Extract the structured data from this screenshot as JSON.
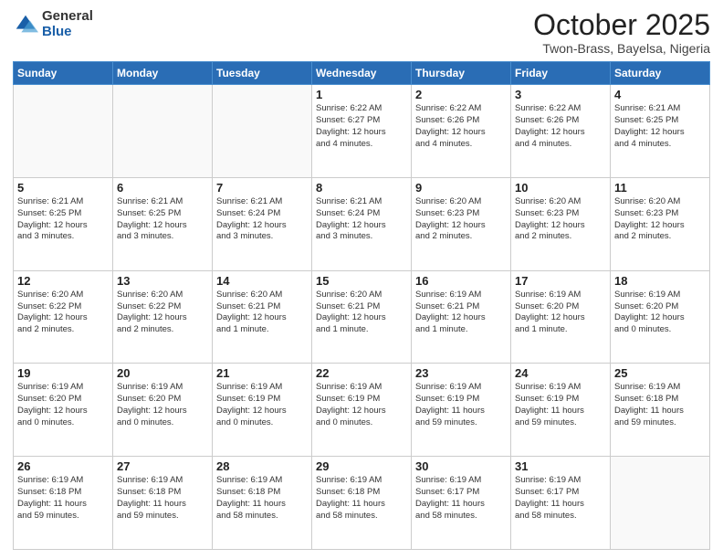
{
  "header": {
    "logo_general": "General",
    "logo_blue": "Blue",
    "main_title": "October 2025",
    "subtitle": "Twon-Brass, Bayelsa, Nigeria"
  },
  "calendar": {
    "headers": [
      "Sunday",
      "Monday",
      "Tuesday",
      "Wednesday",
      "Thursday",
      "Friday",
      "Saturday"
    ],
    "weeks": [
      [
        {
          "day": "",
          "info": ""
        },
        {
          "day": "",
          "info": ""
        },
        {
          "day": "",
          "info": ""
        },
        {
          "day": "1",
          "info": "Sunrise: 6:22 AM\nSunset: 6:27 PM\nDaylight: 12 hours\nand 4 minutes."
        },
        {
          "day": "2",
          "info": "Sunrise: 6:22 AM\nSunset: 6:26 PM\nDaylight: 12 hours\nand 4 minutes."
        },
        {
          "day": "3",
          "info": "Sunrise: 6:22 AM\nSunset: 6:26 PM\nDaylight: 12 hours\nand 4 minutes."
        },
        {
          "day": "4",
          "info": "Sunrise: 6:21 AM\nSunset: 6:25 PM\nDaylight: 12 hours\nand 4 minutes."
        }
      ],
      [
        {
          "day": "5",
          "info": "Sunrise: 6:21 AM\nSunset: 6:25 PM\nDaylight: 12 hours\nand 3 minutes."
        },
        {
          "day": "6",
          "info": "Sunrise: 6:21 AM\nSunset: 6:25 PM\nDaylight: 12 hours\nand 3 minutes."
        },
        {
          "day": "7",
          "info": "Sunrise: 6:21 AM\nSunset: 6:24 PM\nDaylight: 12 hours\nand 3 minutes."
        },
        {
          "day": "8",
          "info": "Sunrise: 6:21 AM\nSunset: 6:24 PM\nDaylight: 12 hours\nand 3 minutes."
        },
        {
          "day": "9",
          "info": "Sunrise: 6:20 AM\nSunset: 6:23 PM\nDaylight: 12 hours\nand 2 minutes."
        },
        {
          "day": "10",
          "info": "Sunrise: 6:20 AM\nSunset: 6:23 PM\nDaylight: 12 hours\nand 2 minutes."
        },
        {
          "day": "11",
          "info": "Sunrise: 6:20 AM\nSunset: 6:23 PM\nDaylight: 12 hours\nand 2 minutes."
        }
      ],
      [
        {
          "day": "12",
          "info": "Sunrise: 6:20 AM\nSunset: 6:22 PM\nDaylight: 12 hours\nand 2 minutes."
        },
        {
          "day": "13",
          "info": "Sunrise: 6:20 AM\nSunset: 6:22 PM\nDaylight: 12 hours\nand 2 minutes."
        },
        {
          "day": "14",
          "info": "Sunrise: 6:20 AM\nSunset: 6:21 PM\nDaylight: 12 hours\nand 1 minute."
        },
        {
          "day": "15",
          "info": "Sunrise: 6:20 AM\nSunset: 6:21 PM\nDaylight: 12 hours\nand 1 minute."
        },
        {
          "day": "16",
          "info": "Sunrise: 6:19 AM\nSunset: 6:21 PM\nDaylight: 12 hours\nand 1 minute."
        },
        {
          "day": "17",
          "info": "Sunrise: 6:19 AM\nSunset: 6:20 PM\nDaylight: 12 hours\nand 1 minute."
        },
        {
          "day": "18",
          "info": "Sunrise: 6:19 AM\nSunset: 6:20 PM\nDaylight: 12 hours\nand 0 minutes."
        }
      ],
      [
        {
          "day": "19",
          "info": "Sunrise: 6:19 AM\nSunset: 6:20 PM\nDaylight: 12 hours\nand 0 minutes."
        },
        {
          "day": "20",
          "info": "Sunrise: 6:19 AM\nSunset: 6:20 PM\nDaylight: 12 hours\nand 0 minutes."
        },
        {
          "day": "21",
          "info": "Sunrise: 6:19 AM\nSunset: 6:19 PM\nDaylight: 12 hours\nand 0 minutes."
        },
        {
          "day": "22",
          "info": "Sunrise: 6:19 AM\nSunset: 6:19 PM\nDaylight: 12 hours\nand 0 minutes."
        },
        {
          "day": "23",
          "info": "Sunrise: 6:19 AM\nSunset: 6:19 PM\nDaylight: 11 hours\nand 59 minutes."
        },
        {
          "day": "24",
          "info": "Sunrise: 6:19 AM\nSunset: 6:19 PM\nDaylight: 11 hours\nand 59 minutes."
        },
        {
          "day": "25",
          "info": "Sunrise: 6:19 AM\nSunset: 6:18 PM\nDaylight: 11 hours\nand 59 minutes."
        }
      ],
      [
        {
          "day": "26",
          "info": "Sunrise: 6:19 AM\nSunset: 6:18 PM\nDaylight: 11 hours\nand 59 minutes."
        },
        {
          "day": "27",
          "info": "Sunrise: 6:19 AM\nSunset: 6:18 PM\nDaylight: 11 hours\nand 59 minutes."
        },
        {
          "day": "28",
          "info": "Sunrise: 6:19 AM\nSunset: 6:18 PM\nDaylight: 11 hours\nand 58 minutes."
        },
        {
          "day": "29",
          "info": "Sunrise: 6:19 AM\nSunset: 6:18 PM\nDaylight: 11 hours\nand 58 minutes."
        },
        {
          "day": "30",
          "info": "Sunrise: 6:19 AM\nSunset: 6:17 PM\nDaylight: 11 hours\nand 58 minutes."
        },
        {
          "day": "31",
          "info": "Sunrise: 6:19 AM\nSunset: 6:17 PM\nDaylight: 11 hours\nand 58 minutes."
        },
        {
          "day": "",
          "info": ""
        }
      ]
    ]
  }
}
